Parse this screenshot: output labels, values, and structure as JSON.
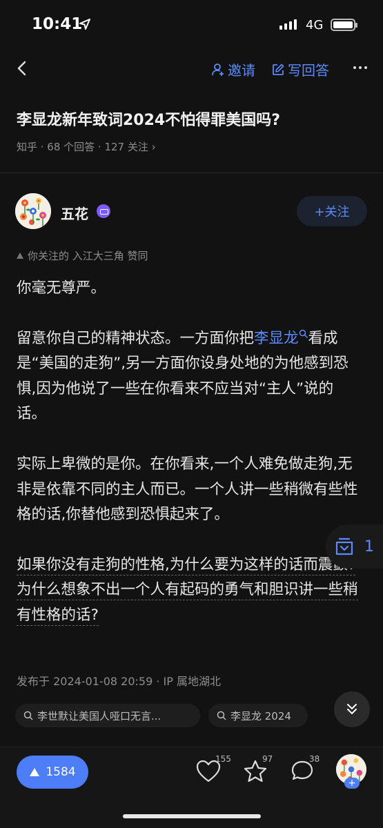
{
  "status": {
    "time": "10:41",
    "network": "4G"
  },
  "nav": {
    "invite_label": "邀请",
    "write_label": "写回答"
  },
  "question": {
    "title": "李显龙新年致词2024不怕得罪美国吗?",
    "meta": "知乎 · 68 个回答 · 127 关注 ›"
  },
  "author": {
    "name": "五花",
    "follow_label": "+关注"
  },
  "liked_by": "你关注的 入江大三角 赞同",
  "answer": {
    "p1": "你毫无尊严。",
    "p2a": "留意你自己的精神状态。一方面你把",
    "p2_link": "李显龙",
    "p2b": "看成是“美国的走狗”,另一方面你设身处地的为他感到恐惧,因为他说了一些在你看来不应当对“主人”说的话。",
    "p3": "实际上卑微的是你。在你看来,一个人难免做走狗,无非是依靠不同的主人而已。一个人讲一些稍微有些性格的话,你替他感到恐惧起来了。",
    "p4": "如果你没有走狗的性格,为什么要为这样的话而震颤?为什么想象不出一个人有起码的勇气和胆识讲一些稍有性格的话?"
  },
  "collect_count": "1",
  "publish_meta": "发布于 2024-01-08 20:59 · IP 属地湖北",
  "chips": [
    "李世默让美国人哑口无言...",
    "李显龙 2024"
  ],
  "actions": {
    "vote_count": "1584",
    "likes": "155",
    "favorites": "97",
    "comments": "38"
  },
  "colors": {
    "accent": "#5b8cff",
    "vote_bg": "#4d7ef7",
    "background": "#121212"
  }
}
